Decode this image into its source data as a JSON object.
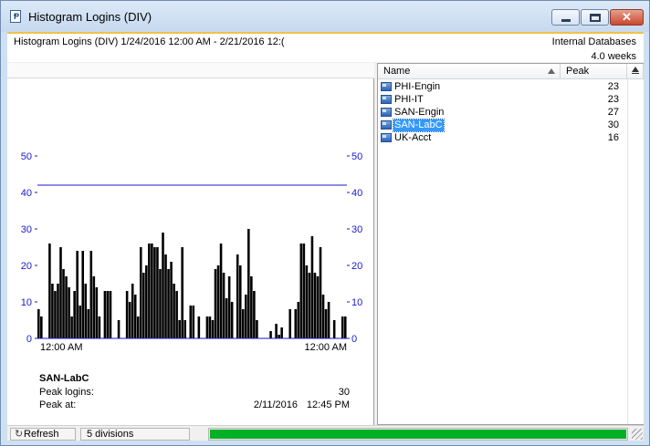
{
  "window": {
    "title": "Histogram Logins (DIV)",
    "close_glyph": "✕"
  },
  "info": {
    "range_text": "Histogram Logins (DIV) 1/24/2016 12:00 AM - 2/21/2016 12:(",
    "source": "Internal Databases",
    "duration": "4.0 weeks"
  },
  "list": {
    "columns": {
      "name": "Name",
      "peak": "Peak"
    },
    "rows": [
      {
        "name": "PHI-Engin",
        "peak": "23",
        "selected": false
      },
      {
        "name": "PHI-IT",
        "peak": "23",
        "selected": false
      },
      {
        "name": "SAN-Engin",
        "peak": "27",
        "selected": false
      },
      {
        "name": "SAN-LabC",
        "peak": "30",
        "selected": true
      },
      {
        "name": "UK-Acct",
        "peak": "16",
        "selected": false
      }
    ]
  },
  "chart_data": {
    "type": "bar",
    "series": [
      {
        "name": "SAN-LabC"
      }
    ],
    "ylim": [
      0,
      50
    ],
    "yticks": [
      "0",
      "10",
      "20",
      "30",
      "40",
      "50"
    ],
    "reference_line": 42,
    "x_start": {
      "time": "12:00 AM",
      "date": "1/24/2016"
    },
    "x_end": {
      "time": "12:00 AM",
      "date": "2/21/2016"
    },
    "values": [
      8,
      6,
      0,
      0,
      26,
      15,
      13,
      15,
      25,
      19,
      17,
      14,
      6,
      13,
      24,
      9,
      24,
      15,
      8,
      24,
      17,
      14,
      6,
      0,
      13,
      13,
      13,
      0,
      0,
      5,
      0,
      0,
      13,
      10,
      15,
      12,
      6,
      25,
      18,
      20,
      26,
      26,
      25,
      25,
      19,
      29,
      23,
      19,
      21,
      15,
      13,
      5,
      25,
      5,
      0,
      9,
      9,
      0,
      6,
      0,
      0,
      6,
      6,
      5,
      19,
      20,
      26,
      18,
      11,
      17,
      10,
      0,
      23,
      20,
      8,
      12,
      30,
      17,
      13,
      5,
      0,
      0,
      0,
      0,
      2,
      0,
      4,
      1,
      3,
      0,
      0,
      8,
      0,
      8,
      10,
      26,
      26,
      20,
      18,
      28,
      18,
      17,
      25,
      12,
      8,
      10,
      0,
      5,
      0,
      0,
      6,
      6
    ]
  },
  "summary": {
    "series_name": "SAN-LabC",
    "peak_logins_label": "Peak logins:",
    "peak_logins_value": "30",
    "peak_at_label": "Peak at:",
    "peak_at_date": "2/11/2016",
    "peak_at_time": "12:45 PM"
  },
  "status": {
    "refresh_label": "Refresh",
    "refresh_icon": "refresh-icon",
    "divisions": "5 divisions",
    "progress": 1.0,
    "progress_color": "#06b025"
  },
  "colors": {
    "axis": "#1a1acc",
    "bar": "#000000",
    "reference_line": "#1a1acc",
    "selection": "#3399ff"
  }
}
